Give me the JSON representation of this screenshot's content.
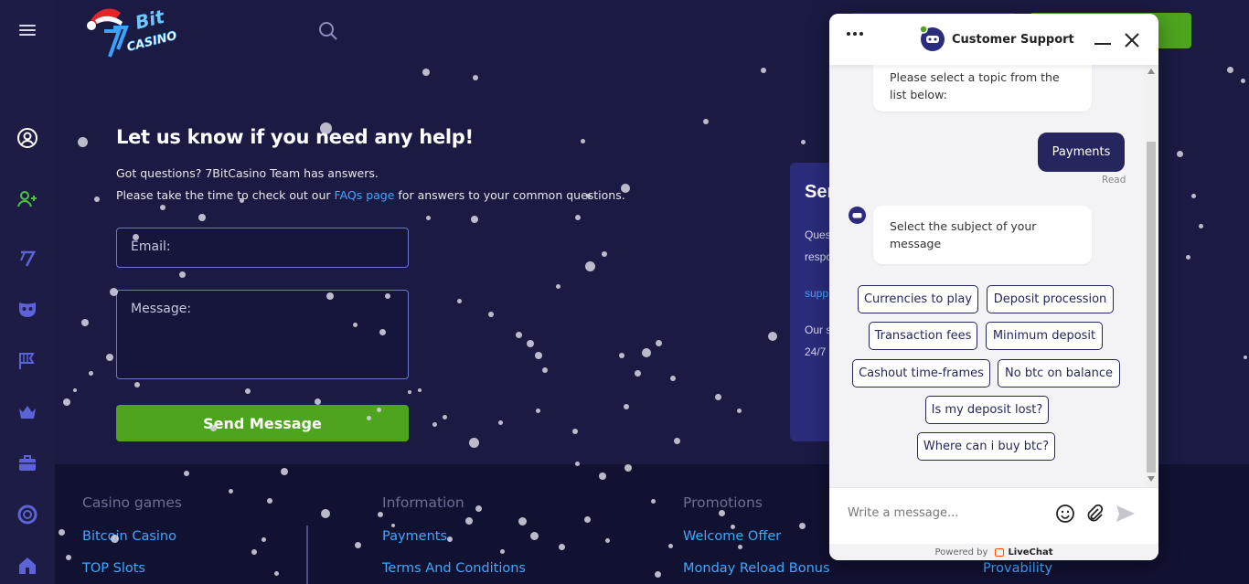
{
  "colors": {
    "accent_green": "#4ea41f",
    "link_blue": "#3ea8ff",
    "bg_navy": "#1a1a43",
    "chat_dark": "#26265e"
  },
  "header": {
    "logo_icon": "7bit-casino-logo",
    "search_icon": "search-icon",
    "menu_icon": "hamburger-icon"
  },
  "sidebar": {
    "icons": [
      "profile-icon",
      "add-user-icon",
      "7bit-icon",
      "mask-icon",
      "flag-icon",
      "crown-icon",
      "briefcase-icon",
      "lifebuoy-icon",
      "home-icon"
    ]
  },
  "help": {
    "title": "Let us know if you need any help!",
    "line1": "Got questions? 7BitCasino Team has answers.",
    "line2_before": "Please take the time to check out our",
    "line2_link": "FAQs page",
    "line2_after": "for answers to your common questions.",
    "email_placeholder": "Email:",
    "message_placeholder": "Message:",
    "send_label": "Send Message"
  },
  "card": {
    "title": "Ser",
    "line1": "Ques",
    "line2": "respo",
    "line3": "supp",
    "line4": "Our s",
    "line5": "24/7"
  },
  "footer": {
    "columns": [
      {
        "title": "Casino games",
        "links": [
          "Bitcoin Casino",
          "TOP Slots"
        ]
      },
      {
        "title": "Information",
        "links": [
          "Payments",
          "Terms And Conditions"
        ]
      },
      {
        "title": "Promotions",
        "links": [
          "Welcome Offer",
          "Monday Reload Bonus"
        ]
      },
      {
        "title": "",
        "links": [
          "Provability"
        ]
      }
    ]
  },
  "chat": {
    "title": "Customer Support",
    "bot_msg_1": "Please select a topic from the list below:",
    "user_msg": "Payments",
    "read_label": "Read",
    "bot_msg_2": "Select the subject of your message",
    "chips": [
      "Currencies to play",
      "Deposit procession",
      "Transaction fees",
      "Minimum deposit",
      "Cashout time-frames",
      "No btc on balance",
      "Is my deposit lost?",
      "Where can i buy btc?"
    ],
    "input_placeholder": "Write a message...",
    "powered_by": "Powered by",
    "brand": "LiveChat"
  }
}
